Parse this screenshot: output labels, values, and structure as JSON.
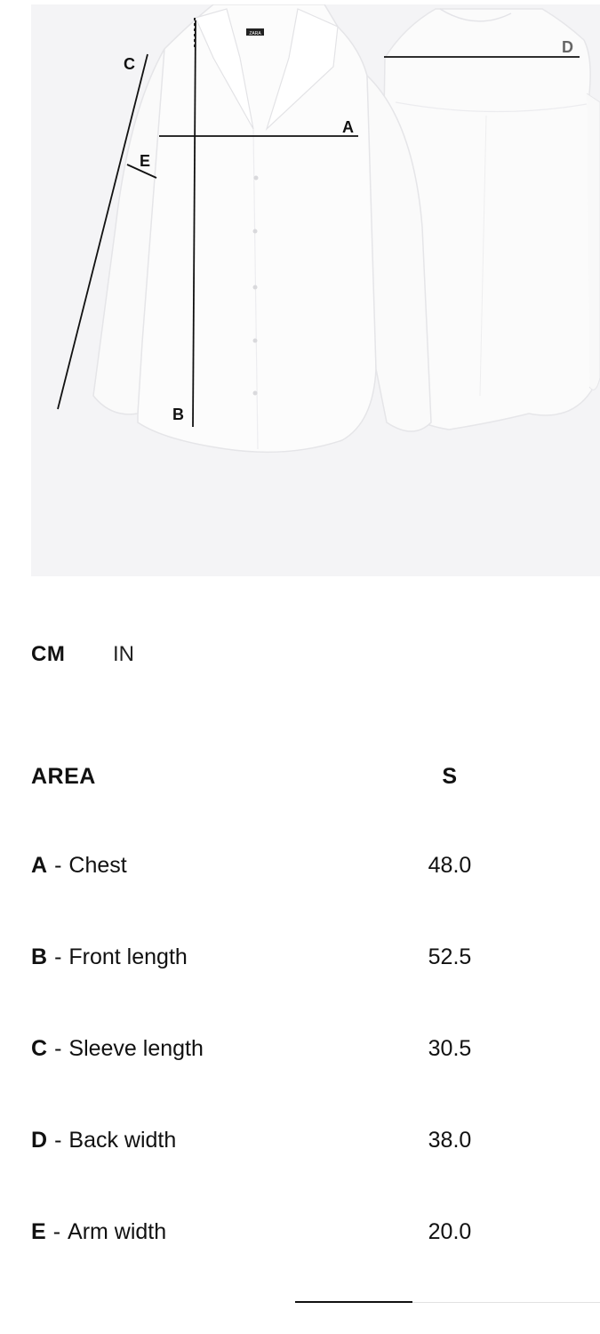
{
  "figure": {
    "labels": {
      "a": "A",
      "b": "B",
      "c": "C",
      "d": "D",
      "e": "E"
    },
    "brand_tag": "ZARA"
  },
  "unit_tabs": [
    {
      "label": "CM",
      "active": true
    },
    {
      "label": "IN",
      "active": false
    }
  ],
  "table": {
    "area_header": "AREA",
    "size_header": "S",
    "rows": [
      {
        "letter": "A",
        "sep": "-",
        "name": "Chest",
        "value": "48.0"
      },
      {
        "letter": "B",
        "sep": "-",
        "name": "Front length",
        "value": "52.5"
      },
      {
        "letter": "C",
        "sep": "-",
        "name": "Sleeve length",
        "value": "30.5"
      },
      {
        "letter": "D",
        "sep": "-",
        "name": "Back width",
        "value": "38.0"
      },
      {
        "letter": "E",
        "sep": "-",
        "name": "Arm width",
        "value": "20.0"
      }
    ]
  },
  "scroll_position": 0.39
}
